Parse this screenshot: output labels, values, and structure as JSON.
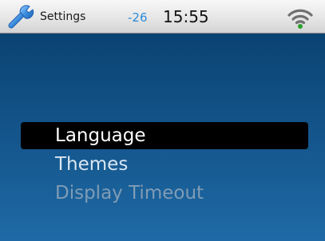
{
  "status_bar": {
    "title": "Settings",
    "title_icon": "wrench-icon",
    "signal_value": "-26",
    "time": "15:55",
    "wifi_icon": "wifi-icon"
  },
  "menu": {
    "items": [
      {
        "label": "Language",
        "selected": true,
        "enabled": true
      },
      {
        "label": "Themes",
        "selected": false,
        "enabled": true
      },
      {
        "label": "Display Timeout",
        "selected": false,
        "enabled": false
      }
    ]
  },
  "colors": {
    "background_top": "#0a4372",
    "background_bottom": "#1f6aa6",
    "selection": "#000000",
    "signal_value": "#2e8ad8",
    "wifi_dot": "#2aa02a"
  }
}
